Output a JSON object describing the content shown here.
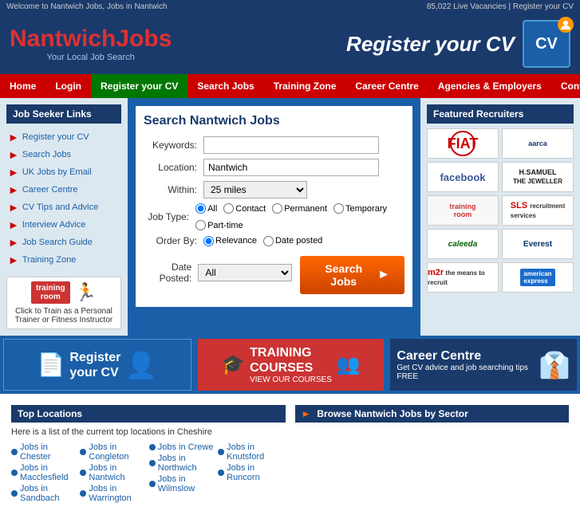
{
  "topbar": {
    "left": "Welcome to Nantwich Jobs, Jobs in Nantwich",
    "right": "85,022 Live Vacancies | Register your CV"
  },
  "logo": {
    "nantwich": "Nantwich",
    "jobs": "Jobs",
    "tagline": "Your Local Job Search"
  },
  "header": {
    "register_text": "Register your CV"
  },
  "nav": {
    "items": [
      {
        "label": "Home",
        "active": false
      },
      {
        "label": "Login",
        "active": false
      },
      {
        "label": "Register your CV",
        "active": false,
        "green": true
      },
      {
        "label": "Search Jobs",
        "active": false
      },
      {
        "label": "Training Zone",
        "active": false
      },
      {
        "label": "Career Centre",
        "active": false
      },
      {
        "label": "Agencies & Employers",
        "active": false
      },
      {
        "label": "Contact Us",
        "active": false
      }
    ]
  },
  "sidebar": {
    "title": "Job Seeker Links",
    "items": [
      "Register your CV",
      "Search Jobs",
      "UK Jobs by Email",
      "Career Centre",
      "CV Tips and Advice",
      "Interview Advice",
      "Job Search Guide",
      "Training Zone"
    ],
    "promo_text": "Click to Train as a Personal Trainer or Fitness Instructor"
  },
  "search": {
    "title": "Search Nantwich Jobs",
    "keywords_label": "Keywords:",
    "location_label": "Location:",
    "location_value": "Nantwich",
    "within_label": "Within:",
    "within_value": "25 miles",
    "jobtype_label": "Job Type:",
    "jobtypes": [
      "All",
      "Contact",
      "Permanent",
      "Temporary",
      "Part-time"
    ],
    "orderby_label": "Order By:",
    "orderby_options": [
      "Relevance",
      "Date posted"
    ],
    "dateposted_label": "Date Posted:",
    "dateposted_value": "All",
    "button_label": "Search Jobs"
  },
  "featured": {
    "title": "Featured Recruiters",
    "recruiters": [
      {
        "name": "Fiat",
        "display": "FIAT"
      },
      {
        "name": "Aarca",
        "display": "aarca"
      },
      {
        "name": "Facebook",
        "display": "facebook"
      },
      {
        "name": "H Samuel",
        "display": "H.SAMUEL\nTHE JEWELLER"
      },
      {
        "name": "Training Room",
        "display": "training room"
      },
      {
        "name": "SLS Recruitment",
        "display": "SLS"
      },
      {
        "name": "Caleeda",
        "display": "caleeda"
      },
      {
        "name": "Everest",
        "display": "Everest"
      },
      {
        "name": "M2R",
        "display": "m2r"
      },
      {
        "name": "American Express",
        "display": "AMEX"
      }
    ]
  },
  "promos": [
    {
      "id": "register",
      "big": "Register\nyour CV",
      "small": ""
    },
    {
      "id": "training",
      "label": "TRAINING",
      "label2": "COURSES",
      "small": "VIEW OUR COURSES"
    },
    {
      "id": "career",
      "big": "Career Centre",
      "small": "Get CV advice and job searching tips FREE"
    }
  ],
  "locations": {
    "title": "Top Locations",
    "subtitle": "Here is a list of the current top locations in Cheshire",
    "items": [
      "Jobs in Chester",
      "Jobs in Macclesfield",
      "Jobs in Sandbach",
      "Jobs in Congleton",
      "Jobs in Nantwich",
      "Jobs in Warrington",
      "Jobs in Crewe",
      "Jobs in Northwich",
      "Jobs in Wilmslow",
      "Jobs in Knutsford",
      "Jobs in Runcorn"
    ]
  },
  "sector": {
    "title": "Browse Nantwich Jobs by Sector"
  }
}
